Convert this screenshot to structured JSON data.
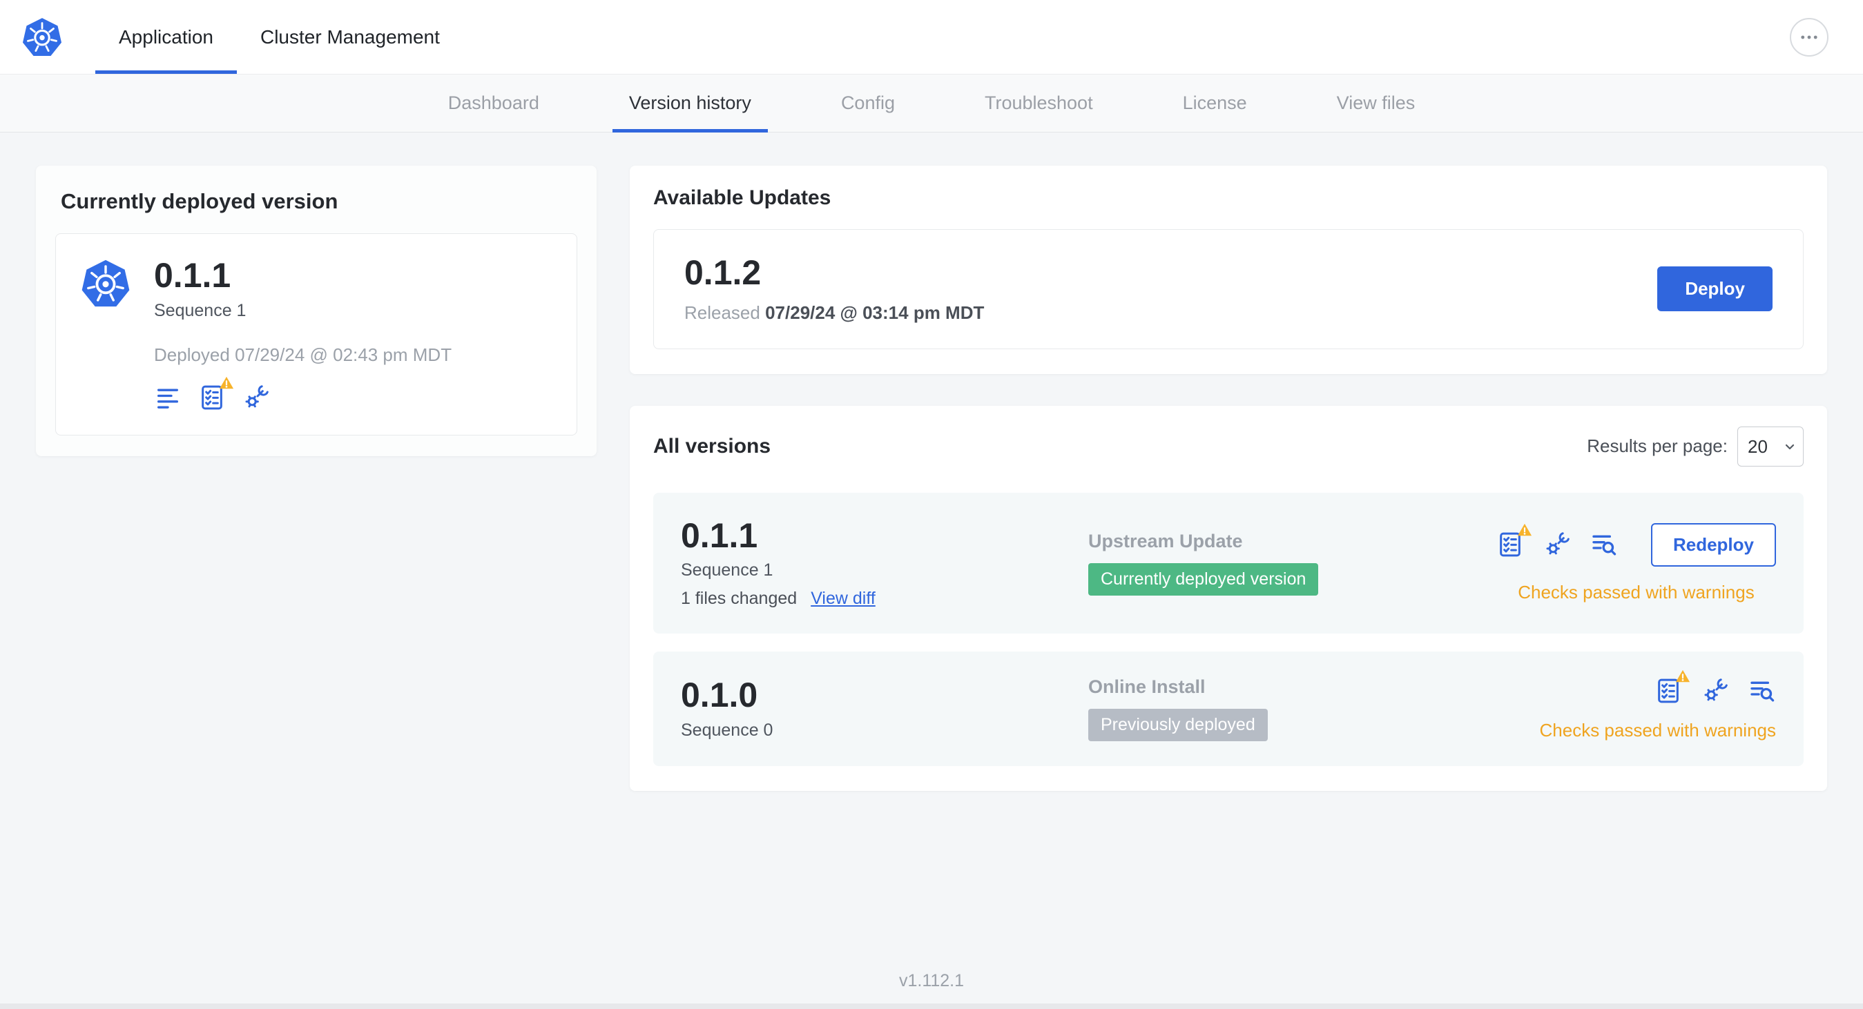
{
  "header": {
    "tabs": [
      {
        "label": "Application",
        "active": true
      },
      {
        "label": "Cluster Management",
        "active": false
      }
    ]
  },
  "subnav": {
    "tabs": [
      {
        "label": "Dashboard",
        "active": false
      },
      {
        "label": "Version history",
        "active": true
      },
      {
        "label": "Config",
        "active": false
      },
      {
        "label": "Troubleshoot",
        "active": false
      },
      {
        "label": "License",
        "active": false
      },
      {
        "label": "View files",
        "active": false
      }
    ]
  },
  "current_version": {
    "title": "Currently deployed version",
    "version": "0.1.1",
    "sequence": "Sequence 1",
    "deployed": "Deployed 07/29/24 @ 02:43 pm MDT"
  },
  "available_updates": {
    "title": "Available Updates",
    "update": {
      "version": "0.1.2",
      "released_label": "Released",
      "released_date": "07/29/24 @ 03:14 pm MDT",
      "deploy_label": "Deploy"
    }
  },
  "all_versions": {
    "title": "All versions",
    "results_per_page_label": "Results per page:",
    "results_per_page_value": "20",
    "rows": [
      {
        "version": "0.1.1",
        "sequence": "Sequence 1",
        "files_changed": "1 files changed",
        "view_diff_label": "View diff",
        "source": "Upstream Update",
        "badge": "Currently deployed version",
        "status": "Checks passed with warnings",
        "action_label": "Redeploy"
      },
      {
        "version": "0.1.0",
        "sequence": "Sequence 0",
        "source": "Online Install",
        "badge": "Previously deployed",
        "status": "Checks passed with warnings"
      }
    ]
  },
  "footer": {
    "app_version": "v1.112.1"
  },
  "icons": {
    "logo": "kubernetes-helm-wheel",
    "more_options": "ellipsis",
    "release_notes": "text-lines",
    "preflight_checks": "checklist",
    "warning": "warning-triangle",
    "edit_config": "wrench-gear",
    "view_logs": "lines-magnifier",
    "select_chevron": "chevron-down"
  },
  "colors": {
    "accent_blue": "#3066dd",
    "logo_blue": "#326de6",
    "badge_green": "#4db884",
    "badge_gray": "#b6bcc5",
    "warning_orange": "#efa420",
    "warning_triangle": "#f7b32b"
  }
}
